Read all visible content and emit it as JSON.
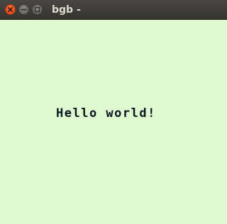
{
  "window": {
    "title": "bgb -"
  },
  "titlebar": {
    "buttons": [
      {
        "name": "close",
        "icon": "close-icon",
        "color": "#e9541f"
      },
      {
        "name": "minimize",
        "icon": "minimize-icon",
        "color": "#6f6c66"
      },
      {
        "name": "maximize",
        "icon": "maximize-icon",
        "color": "#6f6c66"
      }
    ]
  },
  "screen": {
    "background_color": "#e0f8d0",
    "text_color": "#081820",
    "text": "Hello world!"
  }
}
